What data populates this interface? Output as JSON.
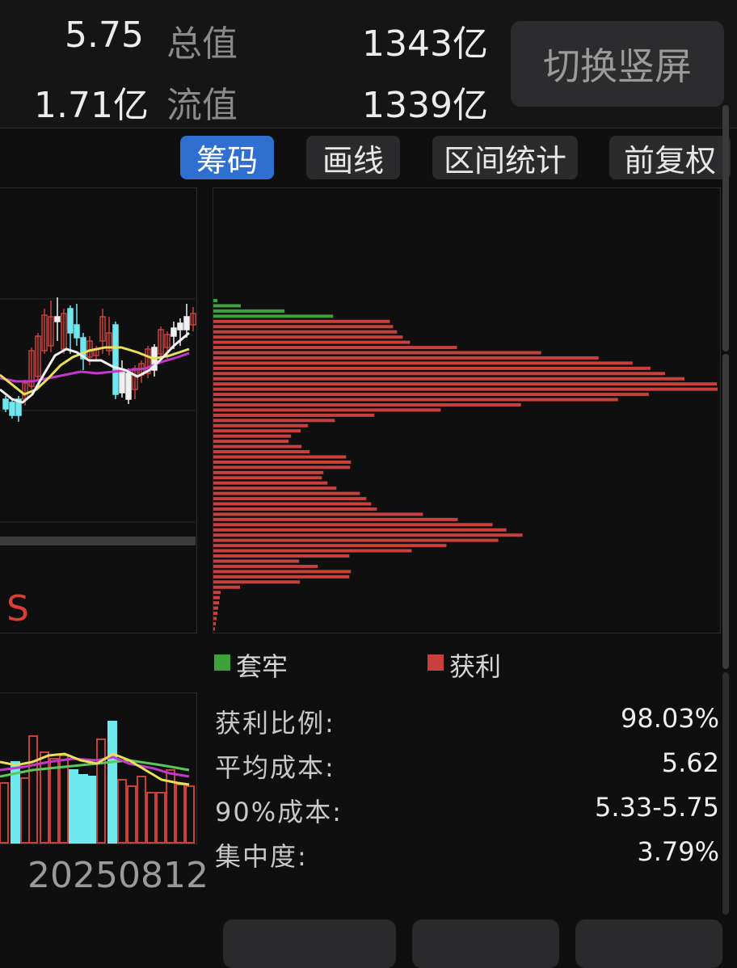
{
  "header": {
    "price": "5.75",
    "total_value_label": "总值",
    "total_value": "1343亿",
    "turnover": "1.71亿",
    "float_value_label": "流值",
    "float_value": "1339亿",
    "switch_button": "切换竖屏"
  },
  "tabs": [
    {
      "label": "筹码",
      "active": true
    },
    {
      "label": "画线",
      "active": false
    },
    {
      "label": "区间统计",
      "active": false
    },
    {
      "label": "前复权",
      "active": false
    }
  ],
  "kline": {
    "signal_label": "S",
    "date_label": "20250812"
  },
  "legend": {
    "trapped_label": "套牢",
    "profit_label": "获利",
    "trapped_color": "#3ca33c",
    "profit_color": "#c8403c"
  },
  "stats": {
    "profit_ratio_label": "获利比例:",
    "profit_ratio": "98.03%",
    "avg_cost_label": "平均成本:",
    "avg_cost": "5.62",
    "cost90_label": "90%成本:",
    "cost90": "5.33-5.75",
    "concentration_label": "集中度:",
    "concentration": "3.79%"
  },
  "chip_distribution": {
    "trapped": [
      5,
      34,
      88,
      148
    ],
    "profit": [
      218,
      222,
      227,
      234,
      243,
      301,
      405,
      476,
      518,
      540,
      558,
      582,
      622,
      623,
      538,
      500,
      380,
      281,
      199,
      150,
      117,
      108,
      96,
      93,
      109,
      119,
      164,
      170,
      169,
      136,
      134,
      141,
      152,
      181,
      189,
      195,
      202,
      259,
      302,
      345,
      362,
      382,
      352,
      288,
      245,
      168,
      106,
      129,
      170,
      168,
      107,
      33,
      9,
      8,
      7,
      6,
      5,
      4,
      3,
      2,
      2,
      1
    ],
    "max": 623
  },
  "colors": {
    "up": "#c8403c",
    "down": "#6fe8f0",
    "ma_white": "#f0f0f0",
    "ma_yellow": "#e8e05a",
    "ma_magenta": "#c238c8",
    "ma_green": "#5ac85a"
  }
}
